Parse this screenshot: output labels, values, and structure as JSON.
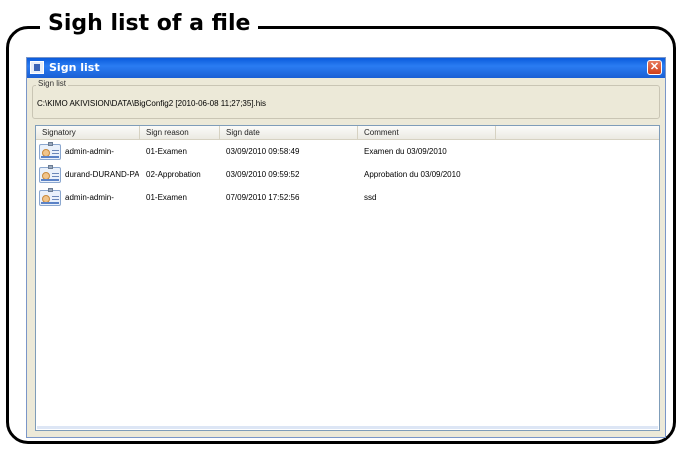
{
  "frame": {
    "title": "Sigh list of a file"
  },
  "window": {
    "title": "Sign list",
    "close_symbol": "✕",
    "title_icon": "app-icon"
  },
  "group": {
    "legend": "Sign list",
    "file_path": "C:\\KIMO AKIVISION\\DATA\\BigConfig2 [2010-06-08 11;27;35].his"
  },
  "table": {
    "columns": [
      "Signatory",
      "Sign reason",
      "Sign date",
      "Comment"
    ],
    "rows": [
      {
        "signatory": "admin-admin-",
        "reason": "01-Examen",
        "date": "03/09/2010 09:58:49",
        "comment": "Examen du 03/09/2010",
        "icon": "id-badge-icon"
      },
      {
        "signatory": "durand-DURAND-PA...",
        "reason": "02-Approbation",
        "date": "03/09/2010 09:59:52",
        "comment": "Approbation du 03/09/2010",
        "icon": "id-badge-icon"
      },
      {
        "signatory": "admin-admin-",
        "reason": "01-Examen",
        "date": "07/09/2010 17:52:56",
        "comment": "ssd",
        "icon": "id-badge-icon"
      }
    ]
  }
}
